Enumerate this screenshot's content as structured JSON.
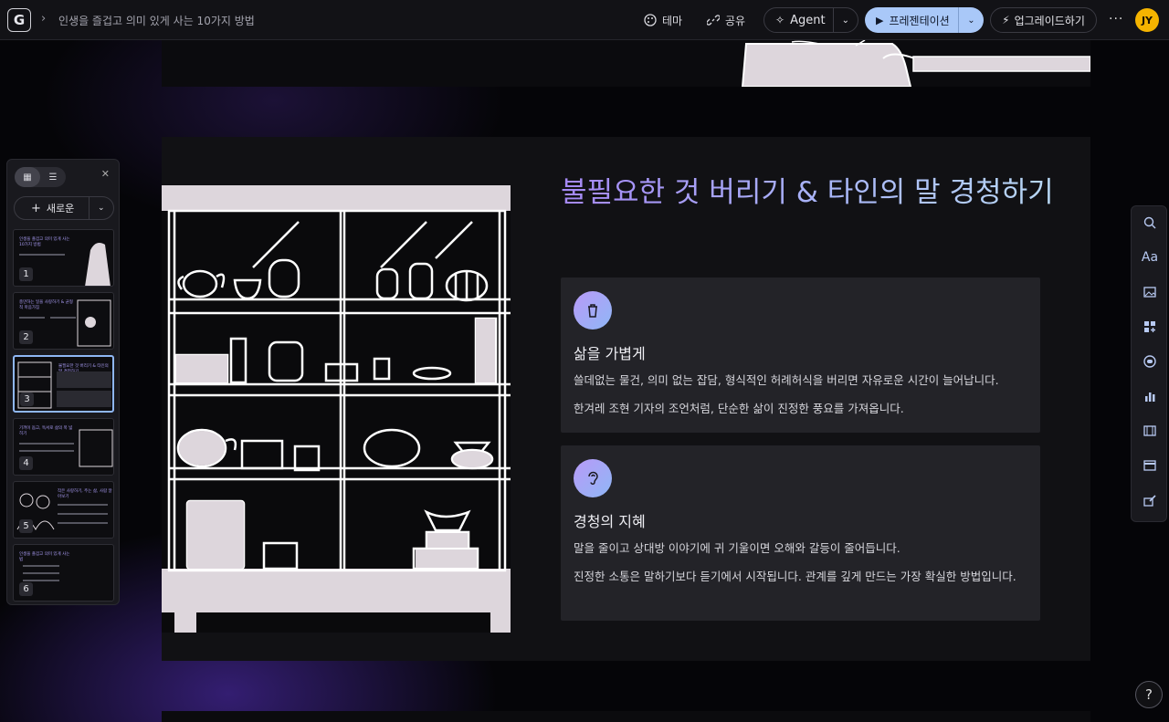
{
  "topbar": {
    "logo": "G",
    "breadcrumb": "인생을 즐겁고 의미 있게 사는 10가지 방법",
    "theme_label": "테마",
    "share_label": "공유",
    "agent_label": "Agent",
    "present_label": "프레젠테이션",
    "upgrade_label": "업그레이드하기",
    "avatar_initials": "JY"
  },
  "panel": {
    "new_label": "새로운",
    "slides": [
      {
        "num": "1",
        "title": "인생을 즐겁고 의미 있게 사는 10가지 방법"
      },
      {
        "num": "2",
        "title": "충만하는 일을 사랑하기 & 균형적 마음가짐"
      },
      {
        "num": "3",
        "title": "불필요한 것 버리기 & 타인의 말 경청하기"
      },
      {
        "num": "4",
        "title": "기꺼이 돕고, 독서로 삶의 폭 넓히기"
      },
      {
        "num": "5",
        "title": "작은 사랑하기, 주는 삶, 사람 알아보기"
      },
      {
        "num": "6",
        "title": "인생을 즐겁고 의미 있게 사는 법"
      }
    ],
    "active_index": 2
  },
  "slide": {
    "title": "불필요한 것 버리기 & 타인의 말 경청하기",
    "cards": [
      {
        "icon": "trash-icon",
        "title": "삶을 가볍게",
        "lines": [
          "쓸데없는 물건, 의미 없는 잡담, 형식적인 허례허식을 버리면 자유로운 시간이 늘어납니다.",
          "한겨레 조현 기자의 조언처럼, 단순한 삶이 진정한 풍요를 가져옵니다."
        ]
      },
      {
        "icon": "ear-icon",
        "title": "경청의 지혜",
        "lines": [
          "말을 줄이고 상대방 이야기에 귀 기울이면 오해와 갈등이 줄어듭니다.",
          "진정한 소통은 말하기보다 듣기에서 시작됩니다. 관계를 깊게 만드는 가장 확실한 방법입니다."
        ]
      }
    ]
  },
  "right_tools": [
    "search-icon",
    "text-style-icon",
    "image-icon",
    "add-block-icon",
    "toggle-icon",
    "chart-icon",
    "video-icon",
    "layout-icon",
    "edit-icon"
  ],
  "help_label": "?",
  "colors": {
    "accent": "#a9c8f8",
    "title_gradient_start": "#a588f5",
    "title_gradient_end": "#b8d8f4",
    "card_bg": "#232328",
    "avatar": "#f5b400"
  }
}
